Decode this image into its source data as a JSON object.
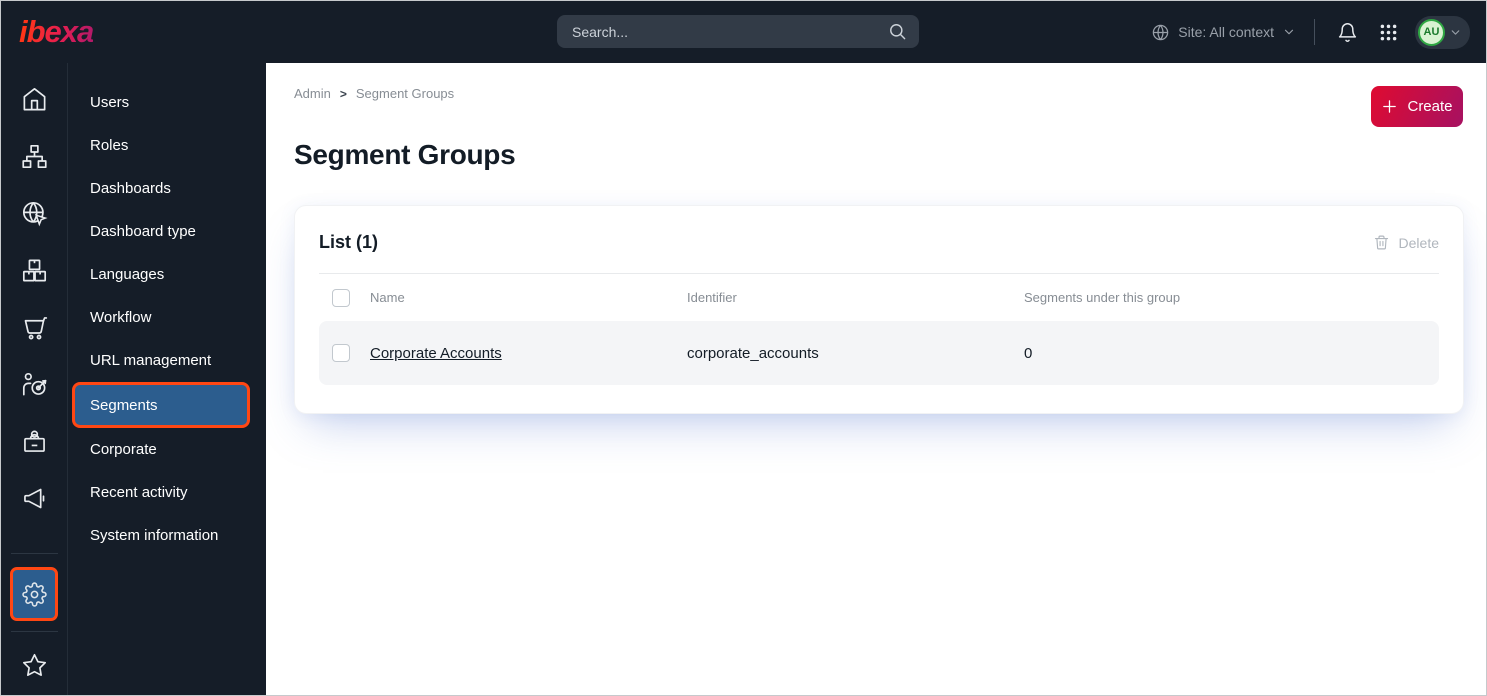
{
  "topbar": {
    "logo_text": "ibexa",
    "search": {
      "placeholder": "Search..."
    },
    "site_context": {
      "label": "Site: All context"
    },
    "avatar": {
      "initials": "AU"
    }
  },
  "icon_rail": {
    "icons": [
      "home-icon",
      "sitemap-icon",
      "globe-cursor-icon",
      "packages-icon",
      "cart-icon",
      "personalization-target-icon",
      "badge-icon",
      "megaphone-icon",
      "gear-icon",
      "star-icon"
    ],
    "active_icon": "gear-icon"
  },
  "sidebar": {
    "items": [
      {
        "label": "Users",
        "active": false
      },
      {
        "label": "Roles",
        "active": false
      },
      {
        "label": "Dashboards",
        "active": false
      },
      {
        "label": "Dashboard type",
        "active": false
      },
      {
        "label": "Languages",
        "active": false
      },
      {
        "label": "Workflow",
        "active": false
      },
      {
        "label": "URL management",
        "active": false
      },
      {
        "label": "Segments",
        "active": true
      },
      {
        "label": "Corporate",
        "active": false
      },
      {
        "label": "Recent activity",
        "active": false
      },
      {
        "label": "System information",
        "active": false
      }
    ]
  },
  "main": {
    "breadcrumb": {
      "items": [
        "Admin",
        "Segment Groups"
      ],
      "separator": ">"
    },
    "title": "Segment Groups",
    "create_button": {
      "label": "Create"
    },
    "list_card": {
      "title": "List (1)",
      "delete_button": {
        "label": "Delete"
      },
      "table": {
        "columns": [
          "Name",
          "Identifier",
          "Segments under this group"
        ],
        "rows": [
          {
            "name": "Corporate Accounts",
            "identifier": "corporate_accounts",
            "segments_count": "0"
          }
        ]
      }
    }
  },
  "colors": {
    "topbar_bg": "#151d28",
    "highlight_orange": "#ff4713",
    "active_blue": "#2c5d8e",
    "create_gradient_start": "#dc0b33",
    "create_gradient_end": "#a9115f",
    "avatar_green": "#2fa743",
    "row_bg": "#f4f5f7"
  }
}
